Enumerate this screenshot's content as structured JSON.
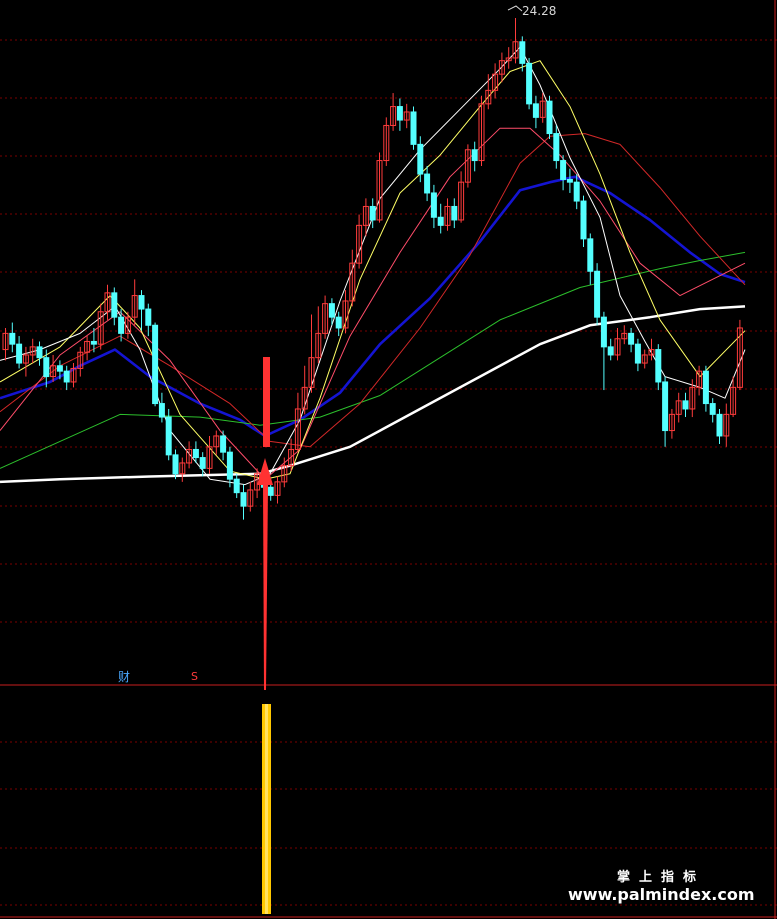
{
  "peak_label": "24.28",
  "markers": {
    "cai": "财",
    "s": "S"
  },
  "watermark": {
    "cn": "掌上指标",
    "url": "www.palmindex.com"
  },
  "colors": {
    "background": "#000000",
    "grid": "#7a0000",
    "divider": "#c81e1e",
    "candle_up": "#ff3c3c",
    "candle_down": "#54ffff",
    "ma5": "#ffffff",
    "ma10": "#ffff66",
    "ma20": "#ff4d6a",
    "ma30": "#d22828",
    "ma60": "#1414d2",
    "ma120": "#2cbf2c",
    "ma250": "#ffffff",
    "ma_long_red": "#e84040",
    "signal_bar": "#ffc800",
    "signal_arrow": "#ff3232"
  },
  "chart_data": {
    "type": "candlestick",
    "peak_value": 24.28,
    "candles": [
      [
        12.0,
        12.6,
        12.8,
        11.6
      ],
      [
        12.6,
        12.2,
        13.0,
        11.9
      ],
      [
        12.2,
        11.5,
        12.5,
        11.3
      ],
      [
        11.5,
        11.8,
        12.1,
        11.0
      ],
      [
        11.8,
        12.1,
        12.4,
        11.5
      ],
      [
        12.1,
        11.7,
        12.3,
        11.4
      ],
      [
        11.7,
        11.0,
        12.0,
        10.6
      ],
      [
        11.0,
        11.4,
        11.8,
        10.8
      ],
      [
        11.4,
        11.2,
        11.6,
        10.9
      ],
      [
        11.2,
        10.8,
        11.4,
        10.5
      ],
      [
        10.8,
        11.3,
        11.5,
        10.6
      ],
      [
        11.3,
        11.9,
        12.1,
        11.0
      ],
      [
        11.9,
        12.3,
        12.5,
        11.6
      ],
      [
        12.3,
        12.2,
        12.8,
        11.9
      ],
      [
        12.2,
        13.4,
        13.7,
        12.0
      ],
      [
        13.4,
        14.1,
        14.4,
        13.1
      ],
      [
        14.1,
        13.2,
        14.3,
        12.9
      ],
      [
        13.2,
        12.6,
        13.5,
        12.3
      ],
      [
        12.6,
        13.2,
        13.4,
        12.4
      ],
      [
        13.2,
        14.0,
        14.6,
        12.9
      ],
      [
        14.0,
        13.5,
        14.2,
        12.7
      ],
      [
        13.5,
        12.9,
        13.7,
        12.5
      ],
      [
        12.9,
        10.0,
        13.0,
        9.9
      ],
      [
        10.0,
        9.5,
        10.4,
        9.3
      ],
      [
        9.5,
        8.1,
        9.8,
        7.9
      ],
      [
        8.1,
        7.4,
        8.3,
        7.2
      ],
      [
        7.4,
        7.8,
        8.0,
        7.1
      ],
      [
        7.8,
        8.3,
        8.6,
        7.6
      ],
      [
        8.3,
        8.0,
        8.6,
        7.8
      ],
      [
        8.0,
        7.6,
        8.2,
        7.3
      ],
      [
        7.6,
        8.4,
        8.8,
        7.4
      ],
      [
        8.4,
        8.8,
        9.0,
        8.1
      ],
      [
        8.8,
        8.2,
        9.0,
        7.9
      ],
      [
        8.2,
        7.2,
        8.4,
        6.9
      ],
      [
        7.2,
        6.7,
        7.4,
        6.5
      ],
      [
        6.7,
        6.2,
        7.0,
        5.7
      ],
      [
        6.2,
        6.8,
        7.1,
        6.0
      ],
      [
        6.8,
        7.4,
        7.6,
        6.5
      ],
      [
        7.4,
        6.9,
        7.7,
        6.7
      ],
      [
        6.9,
        6.6,
        7.1,
        6.4
      ],
      [
        6.6,
        7.1,
        7.3,
        6.3
      ],
      [
        7.1,
        7.7,
        8.0,
        6.9
      ],
      [
        7.7,
        8.3,
        8.7,
        7.5
      ],
      [
        8.3,
        9.8,
        10.4,
        8.2
      ],
      [
        9.8,
        10.6,
        11.4,
        9.6
      ],
      [
        10.6,
        11.7,
        13.3,
        10.4
      ],
      [
        11.7,
        12.6,
        13.6,
        11.5
      ],
      [
        12.6,
        13.7,
        14.0,
        12.4
      ],
      [
        13.7,
        13.2,
        13.9,
        12.9
      ],
      [
        13.2,
        12.8,
        13.4,
        12.5
      ],
      [
        12.8,
        13.8,
        14.2,
        12.6
      ],
      [
        13.8,
        15.2,
        15.7,
        13.6
      ],
      [
        15.2,
        16.6,
        17.0,
        15.0
      ],
      [
        16.6,
        17.3,
        17.6,
        16.2
      ],
      [
        17.3,
        16.8,
        17.6,
        16.5
      ],
      [
        16.8,
        19.0,
        19.3,
        16.7
      ],
      [
        19.0,
        20.3,
        20.6,
        18.8
      ],
      [
        20.3,
        21.0,
        21.5,
        20.1
      ],
      [
        21.0,
        20.5,
        21.3,
        20.1
      ],
      [
        20.5,
        20.8,
        21.1,
        20.2
      ],
      [
        20.8,
        19.6,
        21.0,
        19.4
      ],
      [
        19.6,
        18.5,
        19.9,
        18.2
      ],
      [
        18.5,
        17.8,
        18.8,
        17.5
      ],
      [
        17.8,
        16.9,
        18.1,
        16.5
      ],
      [
        16.9,
        16.6,
        17.4,
        16.3
      ],
      [
        16.6,
        17.3,
        17.6,
        16.4
      ],
      [
        17.3,
        16.8,
        17.6,
        16.5
      ],
      [
        16.8,
        18.2,
        18.6,
        16.7
      ],
      [
        18.2,
        19.4,
        19.6,
        18.0
      ],
      [
        19.4,
        19.0,
        19.7,
        18.6
      ],
      [
        19.0,
        21.1,
        21.4,
        18.8
      ],
      [
        21.1,
        21.6,
        22.2,
        20.9
      ],
      [
        21.6,
        22.2,
        22.6,
        21.3
      ],
      [
        22.2,
        22.7,
        23.0,
        21.9
      ],
      [
        22.7,
        22.8,
        23.2,
        22.4
      ],
      [
        22.8,
        23.4,
        24.28,
        22.6
      ],
      [
        23.4,
        22.6,
        23.6,
        22.3
      ],
      [
        22.6,
        21.1,
        22.8,
        20.9
      ],
      [
        21.1,
        20.6,
        21.4,
        20.2
      ],
      [
        20.6,
        21.2,
        21.5,
        20.4
      ],
      [
        21.2,
        20.0,
        21.4,
        19.8
      ],
      [
        20.0,
        19.0,
        20.3,
        18.7
      ],
      [
        19.0,
        18.3,
        19.2,
        17.9
      ],
      [
        18.3,
        18.2,
        18.7,
        17.8
      ],
      [
        18.2,
        17.5,
        18.5,
        17.2
      ],
      [
        17.5,
        16.1,
        17.7,
        15.8
      ],
      [
        16.1,
        14.9,
        16.3,
        14.4
      ],
      [
        14.9,
        13.2,
        15.2,
        12.9
      ],
      [
        13.2,
        12.1,
        13.4,
        10.5
      ],
      [
        12.1,
        11.8,
        12.4,
        11.6
      ],
      [
        11.8,
        12.4,
        12.8,
        11.6
      ],
      [
        12.4,
        12.6,
        12.9,
        12.2
      ],
      [
        12.6,
        12.2,
        12.8,
        11.9
      ],
      [
        12.2,
        11.5,
        12.4,
        11.2
      ],
      [
        11.5,
        11.8,
        12.0,
        11.3
      ],
      [
        11.8,
        12.0,
        12.4,
        11.6
      ],
      [
        12.0,
        10.8,
        12.2,
        10.5
      ],
      [
        10.8,
        9.0,
        11.0,
        8.4
      ],
      [
        9.0,
        9.6,
        9.8,
        8.7
      ],
      [
        9.6,
        10.1,
        10.4,
        9.3
      ],
      [
        10.1,
        9.8,
        10.4,
        9.5
      ],
      [
        9.8,
        10.6,
        10.9,
        9.5
      ],
      [
        10.6,
        11.2,
        11.4,
        10.3
      ],
      [
        11.2,
        10.0,
        11.4,
        9.7
      ],
      [
        10.0,
        9.6,
        10.2,
        9.3
      ],
      [
        9.6,
        8.8,
        9.8,
        8.5
      ],
      [
        8.8,
        9.6,
        10.0,
        8.4
      ],
      [
        9.6,
        10.6,
        11.0,
        9.5
      ],
      [
        10.6,
        12.8,
        13.1,
        10.5
      ]
    ],
    "ma_lines": {
      "ma250": [
        [
          0,
          7.1
        ],
        [
          60,
          7.2
        ],
        [
          150,
          7.3
        ],
        [
          260,
          7.4
        ],
        [
          290,
          7.7
        ],
        [
          350,
          8.4
        ],
        [
          420,
          9.8
        ],
        [
          480,
          11.0
        ],
        [
          540,
          12.2
        ],
        [
          590,
          12.9
        ],
        [
          650,
          13.2
        ],
        [
          700,
          13.5
        ],
        [
          745,
          13.6
        ]
      ],
      "ma60": [
        [
          0,
          10.2
        ],
        [
          50,
          10.8
        ],
        [
          80,
          11.4
        ],
        [
          115,
          12.0
        ],
        [
          150,
          11.0
        ],
        [
          200,
          10.0
        ],
        [
          240,
          9.4
        ],
        [
          265,
          8.8
        ],
        [
          300,
          9.4
        ],
        [
          340,
          10.4
        ],
        [
          380,
          12.2
        ],
        [
          430,
          13.9
        ],
        [
          480,
          16.0
        ],
        [
          520,
          17.9
        ],
        [
          550,
          18.2
        ],
        [
          575,
          18.4
        ],
        [
          610,
          17.8
        ],
        [
          650,
          16.8
        ],
        [
          690,
          15.6
        ],
        [
          720,
          14.8
        ],
        [
          745,
          14.5
        ]
      ],
      "ma120": [
        [
          0,
          7.6
        ],
        [
          60,
          8.6
        ],
        [
          120,
          9.6
        ],
        [
          200,
          9.5
        ],
        [
          260,
          9.2
        ],
        [
          320,
          9.5
        ],
        [
          380,
          10.3
        ],
        [
          440,
          11.7
        ],
        [
          500,
          13.1
        ],
        [
          580,
          14.3
        ],
        [
          660,
          15.0
        ],
        [
          700,
          15.3
        ],
        [
          745,
          15.6
        ]
      ],
      "ma30": [
        [
          0,
          9.7
        ],
        [
          60,
          11.4
        ],
        [
          120,
          12.5
        ],
        [
          170,
          11.4
        ],
        [
          230,
          10.0
        ],
        [
          270,
          8.6
        ],
        [
          310,
          8.4
        ],
        [
          360,
          10.0
        ],
        [
          420,
          12.8
        ],
        [
          470,
          15.5
        ],
        [
          520,
          18.9
        ],
        [
          550,
          19.9
        ],
        [
          585,
          20.0
        ],
        [
          620,
          19.6
        ],
        [
          660,
          18.0
        ],
        [
          700,
          16.2
        ],
        [
          745,
          14.4
        ]
      ],
      "ma20": [
        [
          0,
          9.0
        ],
        [
          60,
          11.8
        ],
        [
          120,
          13.4
        ],
        [
          170,
          11.6
        ],
        [
          220,
          9.0
        ],
        [
          265,
          7.2
        ],
        [
          300,
          8.3
        ],
        [
          350,
          12.5
        ],
        [
          400,
          15.6
        ],
        [
          450,
          18.4
        ],
        [
          500,
          20.2
        ],
        [
          530,
          20.2
        ],
        [
          560,
          19.2
        ],
        [
          600,
          17.5
        ],
        [
          640,
          15.2
        ],
        [
          680,
          14.0
        ],
        [
          745,
          15.2
        ]
      ],
      "ma10": [
        [
          0,
          10.8
        ],
        [
          60,
          12.1
        ],
        [
          110,
          14.0
        ],
        [
          140,
          12.8
        ],
        [
          180,
          9.6
        ],
        [
          230,
          7.5
        ],
        [
          265,
          7.2
        ],
        [
          290,
          7.4
        ],
        [
          320,
          10.2
        ],
        [
          360,
          14.6
        ],
        [
          400,
          17.8
        ],
        [
          440,
          19.2
        ],
        [
          480,
          21.0
        ],
        [
          510,
          22.3
        ],
        [
          540,
          22.7
        ],
        [
          570,
          21.0
        ],
        [
          600,
          18.5
        ],
        [
          630,
          15.6
        ],
        [
          660,
          13.1
        ],
        [
          700,
          11.0
        ],
        [
          745,
          12.7
        ]
      ],
      "ma5": [
        [
          0,
          11.6
        ],
        [
          40,
          12.0
        ],
        [
          80,
          12.6
        ],
        [
          115,
          13.6
        ],
        [
          140,
          12.0
        ],
        [
          170,
          9.0
        ],
        [
          210,
          7.2
        ],
        [
          245,
          7.0
        ],
        [
          270,
          7.4
        ],
        [
          300,
          9.4
        ],
        [
          340,
          13.8
        ],
        [
          380,
          17.6
        ],
        [
          420,
          19.4
        ],
        [
          460,
          20.9
        ],
        [
          500,
          22.4
        ],
        [
          520,
          23.2
        ],
        [
          540,
          21.8
        ],
        [
          570,
          19.1
        ],
        [
          600,
          16.9
        ],
        [
          620,
          14.0
        ],
        [
          645,
          12.3
        ],
        [
          665,
          11.0
        ],
        [
          700,
          10.6
        ],
        [
          725,
          10.2
        ],
        [
          745,
          12.0
        ]
      ]
    }
  }
}
